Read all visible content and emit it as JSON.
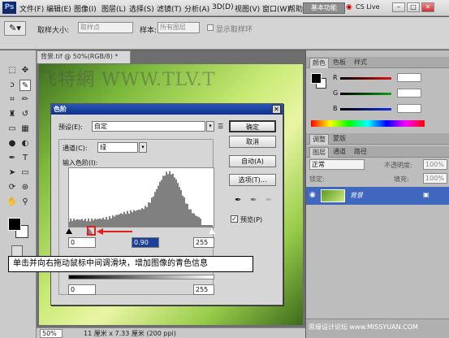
{
  "app": {
    "logo": "Ps"
  },
  "menubar": {
    "items": [
      "文件(F)",
      "编辑(E)",
      "图像(I)",
      "图层(L)",
      "选择(S)",
      "滤镜(T)",
      "分析(A)",
      "3D(D)",
      "视图(V)",
      "窗口(W)",
      "帮助(H)"
    ],
    "workspace": "基本功能",
    "cslive": "CS Live",
    "win_min": "–",
    "win_restore": "□",
    "win_close": "✕"
  },
  "options": {
    "sample_size_label": "取样大小:",
    "sample_size_value": "取样点",
    "sample_label": "样本:",
    "sample_value": "所有图层",
    "show_ring_label": "显示取样环"
  },
  "document": {
    "tab": "背景.tif @ 50%(RGB/8) *",
    "close": "×",
    "watermark": "飞特網 WWW.TLV.T",
    "zoom": "50%",
    "status_info": "11 厘米 x 7.33 厘米 (200 ppi)"
  },
  "panels": {
    "color_tabs": [
      "颜色",
      "色板",
      "样式"
    ],
    "color_channels": [
      {
        "label": "R",
        "color": "#e01010",
        "level": 0.0
      },
      {
        "label": "G",
        "color": "#10a010",
        "level": 0.0
      },
      {
        "label": "B",
        "color": "#1030e0",
        "level": 0.0
      }
    ],
    "adjust_tabs": [
      "调整",
      "蒙版"
    ],
    "layer_tabs": [
      "图层",
      "通道",
      "路径"
    ],
    "blend_mode": "正常",
    "opacity_label": "不透明度:",
    "opacity_value": "100%",
    "lock_label": "锁定:",
    "fill_label": "填充:",
    "fill_value": "100%",
    "layer_name": "背景"
  },
  "dialog": {
    "title": "色阶",
    "preset_label": "预设(E):",
    "preset_value": "自定",
    "channel_label": "通道(C):",
    "channel_value": "绿",
    "input_levels_label": "输入色阶(I):",
    "input_black": "0",
    "input_gray": "0.90",
    "input_white": "255",
    "output_black": "0",
    "output_white": "255",
    "buttons": {
      "ok": "确定",
      "cancel": "取消",
      "auto": "自动(A)",
      "options": "选项(T)..."
    },
    "preview_label": "预览(P)",
    "close": "✕"
  },
  "callout": {
    "text": "单击并向右拖动鼠标中间调滑块，增加图像的青色信息"
  },
  "credit": "思缘设计论坛  www.MISSYUAN.COM",
  "colors": {
    "accent_red": "#e02020",
    "title_blue": "#0c2f8c"
  }
}
